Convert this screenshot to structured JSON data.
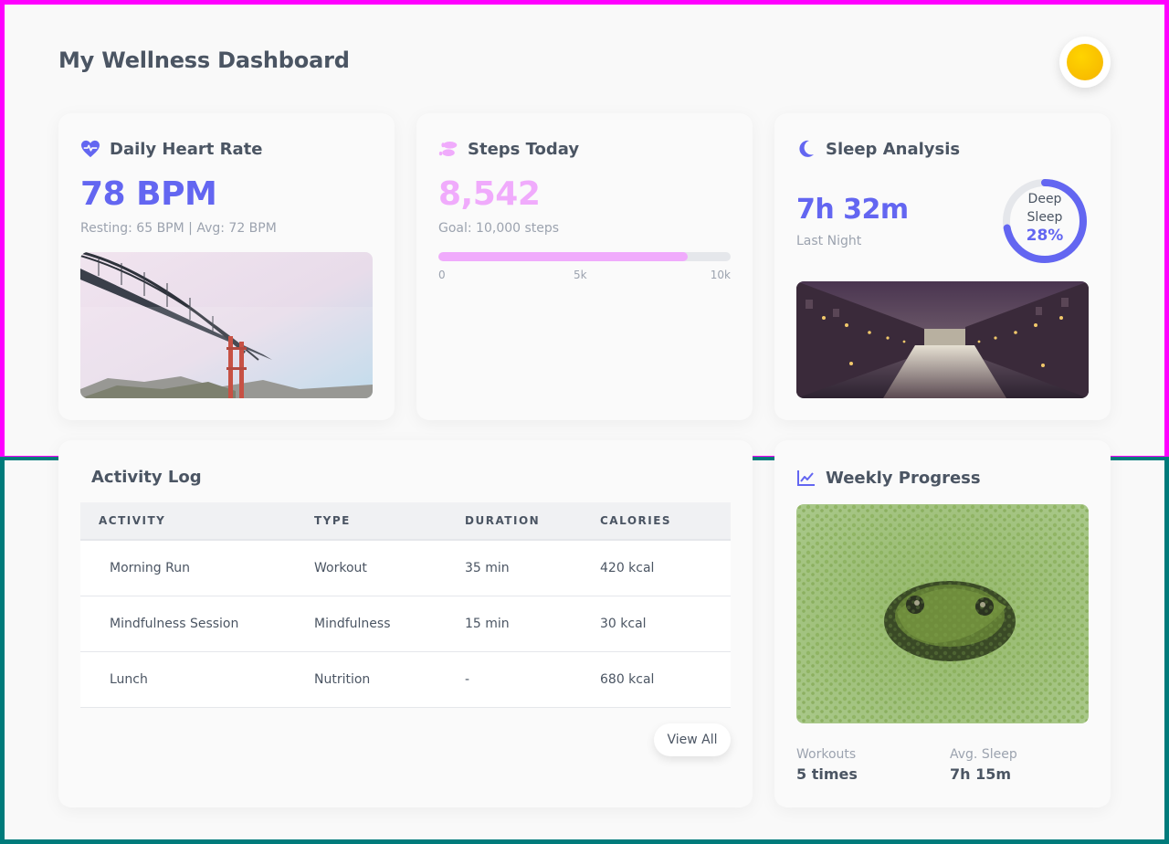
{
  "header": {
    "title": "My Wellness Dashboard",
    "theme_toggle_icon": "sun-icon"
  },
  "colors": {
    "accent_indigo": "#6366f1",
    "accent_pink": "#f0abfc",
    "sun": "#ffc800",
    "frame_top": "#ff00ff",
    "frame_bottom": "#007b7b"
  },
  "heart": {
    "title": "Daily Heart Rate",
    "icon": "heart-pulse-icon",
    "value": "78 BPM",
    "detail": "Resting: 65 BPM | Avg: 72 BPM",
    "photo": "golden-gate-bridge-fog-photo"
  },
  "steps": {
    "title": "Steps Today",
    "icon": "footprints-icon",
    "value": "8,542",
    "goal": "Goal: 10,000 steps",
    "progress_fraction": 0.8542,
    "ticks": [
      "0",
      "5k",
      "10k"
    ]
  },
  "sleep": {
    "title": "Sleep Analysis",
    "icon": "moon-icon",
    "value": "7h 32m",
    "caption": "Last Night",
    "ring_label_1": "Deep",
    "ring_label_2": "Sleep",
    "ring_pct": "28%",
    "ring_fraction": 0.72,
    "photo": "canal-street-night-photo"
  },
  "activity": {
    "title": "Activity Log",
    "columns": [
      "ACTIVITY",
      "TYPE",
      "DURATION",
      "CALORIES"
    ],
    "rows": [
      [
        "Morning Run",
        "Workout",
        "35 min",
        "420 kcal"
      ],
      [
        "Mindfulness Session",
        "Mindfulness",
        "15 min",
        "30 kcal"
      ],
      [
        "Lunch",
        "Nutrition",
        "-",
        "680 kcal"
      ]
    ],
    "view_all": "View All"
  },
  "weekly": {
    "title": "Weekly Progress",
    "icon": "line-chart-icon",
    "photo": "frog-in-duckweed-photo",
    "workouts_label": "Workouts",
    "workouts_value": "5 times",
    "sleep_label": "Avg. Sleep",
    "sleep_value": "7h 15m"
  }
}
